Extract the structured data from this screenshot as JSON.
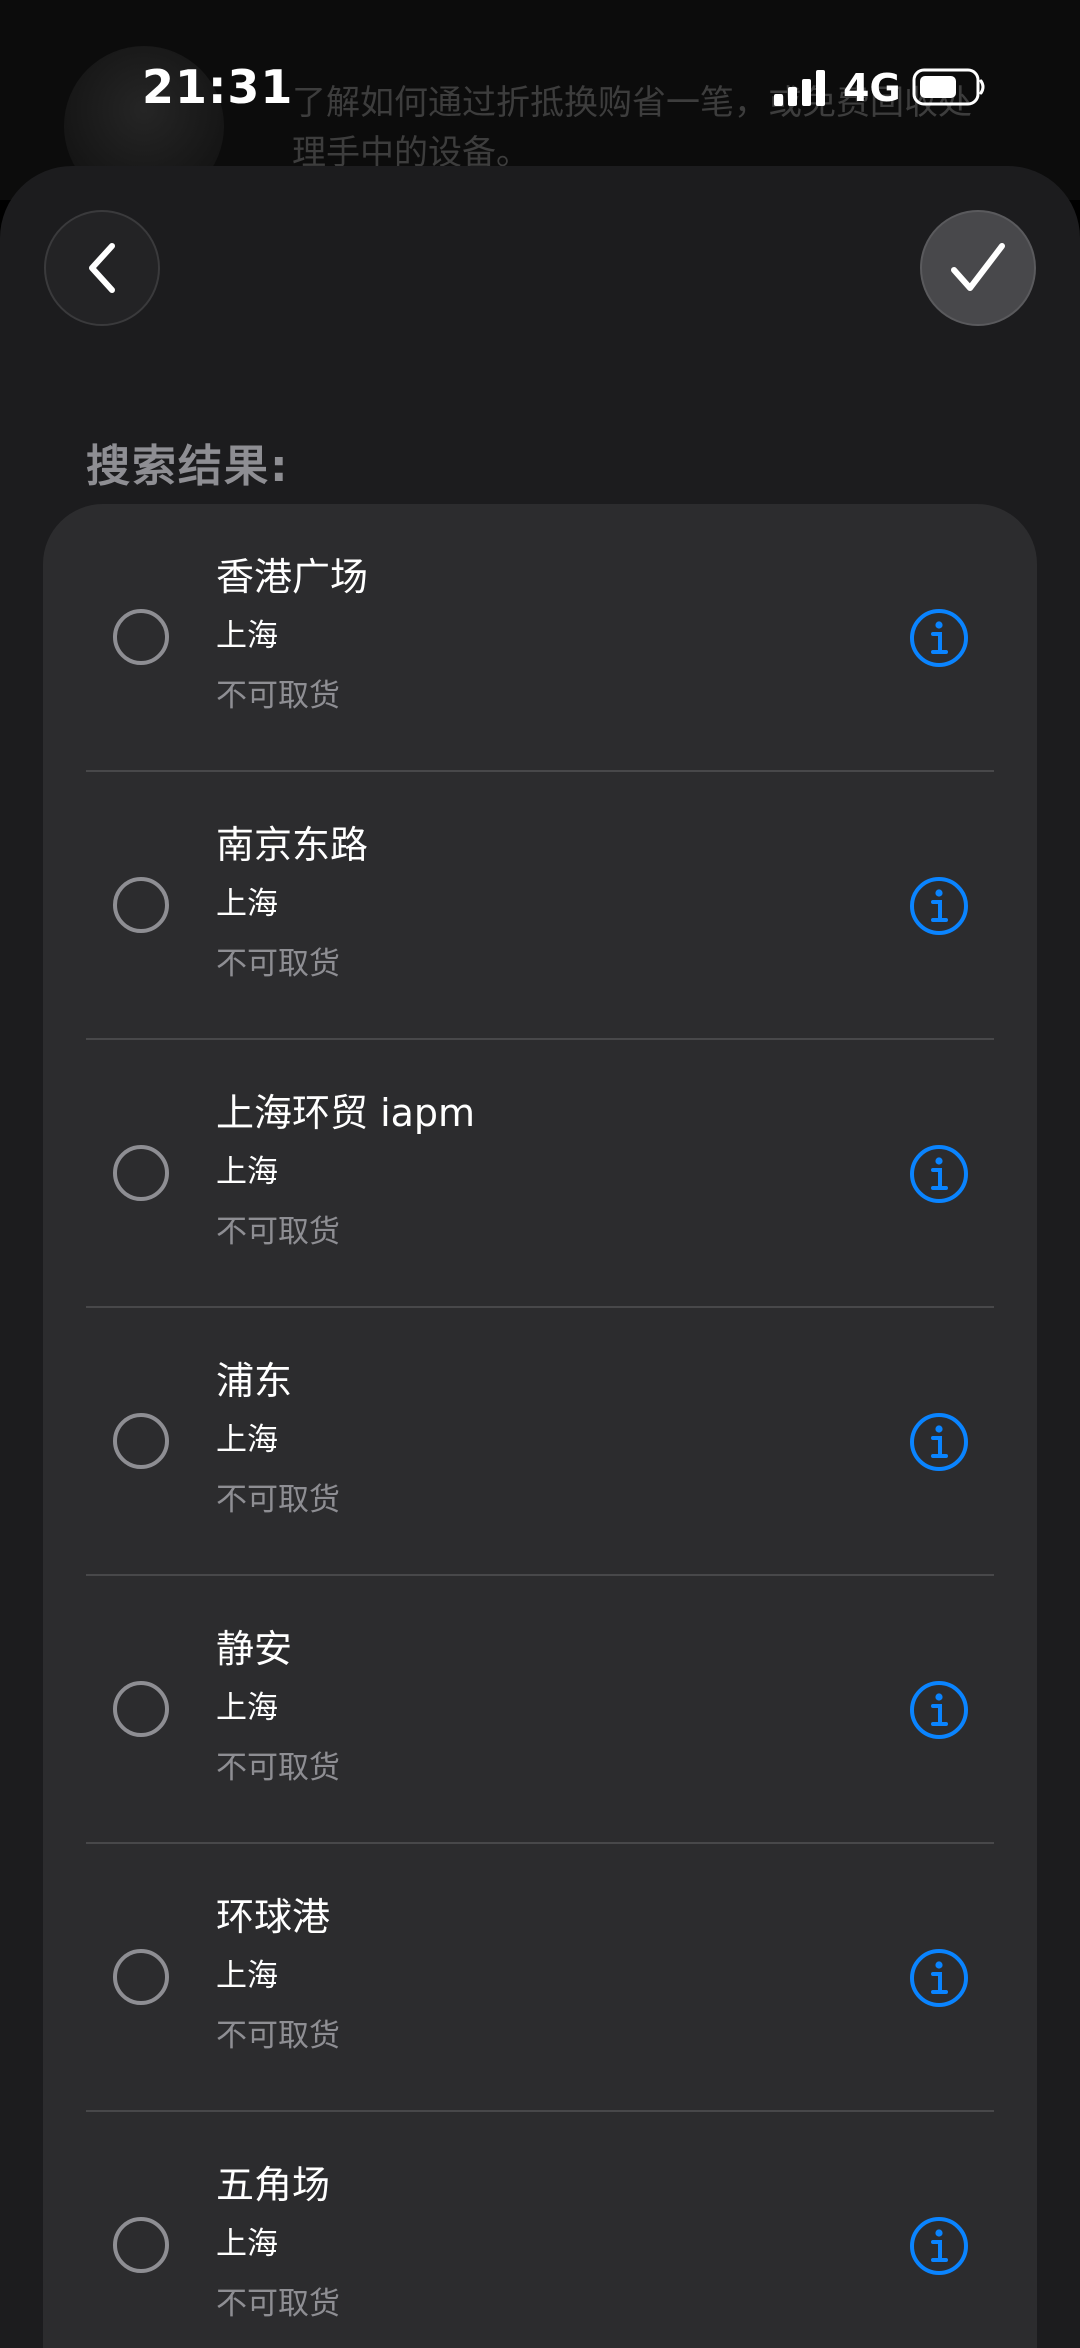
{
  "status_bar": {
    "time": "21:31",
    "network": "4G",
    "signal_icon": "cellular-signal-icon",
    "battery_icon": "battery-icon"
  },
  "background_page": {
    "text": "了解如何通过折抵换购省一笔，或免费回收处理手中的设备。"
  },
  "toolbar": {
    "back_icon": "chevron-left-icon",
    "confirm_icon": "checkmark-icon"
  },
  "section_title": "搜索结果:",
  "results": [
    {
      "name": "香港广场",
      "city": "上海",
      "status": "不可取货"
    },
    {
      "name": "南京东路",
      "city": "上海",
      "status": "不可取货"
    },
    {
      "name": "上海环贸 iapm",
      "city": "上海",
      "status": "不可取货"
    },
    {
      "name": "浦东",
      "city": "上海",
      "status": "不可取货"
    },
    {
      "name": "静安",
      "city": "上海",
      "status": "不可取货"
    },
    {
      "name": "环球港",
      "city": "上海",
      "status": "不可取货"
    },
    {
      "name": "五角场",
      "city": "上海",
      "status": "不可取货"
    }
  ],
  "colors": {
    "accent": "#0a84ff",
    "sheet_background": "#1c1c1e",
    "card_background": "#2c2c2e",
    "secondary_text": "#8e8e93"
  }
}
